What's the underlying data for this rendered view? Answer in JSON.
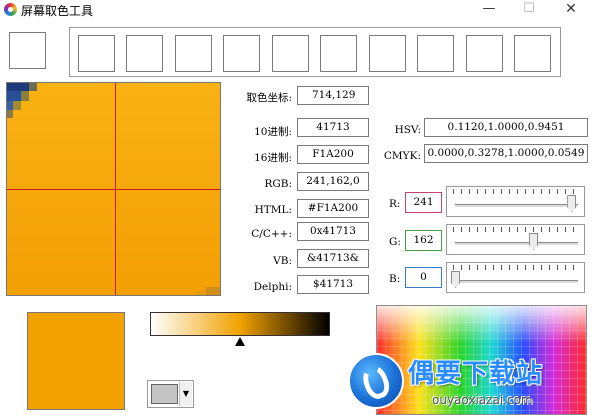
{
  "window": {
    "title": "屏幕取色工具",
    "minimize_glyph": "—",
    "maximize_glyph": "☐",
    "close_glyph": "✕"
  },
  "history": {
    "slot_count": 10
  },
  "fields": {
    "coord": {
      "label": "取色坐标:",
      "value": "714,129"
    },
    "dec": {
      "label": "10进制:",
      "value": "41713"
    },
    "hex": {
      "label": "16进制:",
      "value": "F1A200"
    },
    "rgb": {
      "label": "RGB:",
      "value": "241,162,0"
    },
    "html": {
      "label": "HTML:",
      "value": "#F1A200"
    },
    "cpp": {
      "label": "C/C++:",
      "value": "0x41713"
    },
    "vb": {
      "label": "VB:",
      "value": "&41713&"
    },
    "delphi": {
      "label": "Delphi:",
      "value": "$41713"
    },
    "hsv": {
      "label": "HSV:",
      "value": "0.1120,1.0000,0.9451"
    },
    "cmyk": {
      "label": "CMYK:",
      "value": "0.0000,0.3278,1.0000,0.0549"
    }
  },
  "channels": {
    "r": {
      "label": "R:",
      "value": "241",
      "border_color": "#c0446e",
      "level": 0.945
    },
    "g": {
      "label": "G:",
      "value": "162",
      "border_color": "#4a9a4a",
      "level": 0.635
    },
    "b": {
      "label": "B:",
      "value": "0",
      "border_color": "#3a7abf",
      "level": 0.0
    }
  },
  "current_color": "#F1A200",
  "gradient_marker_level": 0.5,
  "combo": {
    "arrow_glyph": "▼"
  },
  "watermark": {
    "title": "偶要下载站",
    "url": "ouyaoxiazai.com"
  }
}
